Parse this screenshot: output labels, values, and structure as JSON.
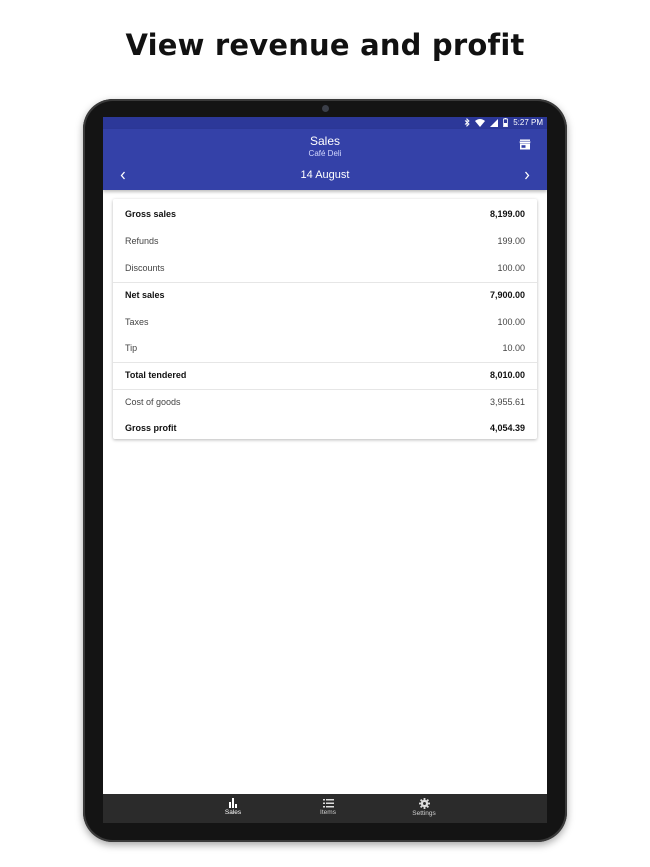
{
  "promo": {
    "headline": "View revenue and profit"
  },
  "status_bar": {
    "time": "5:27 PM",
    "icons": [
      "bluetooth-icon",
      "wifi-icon",
      "signal-icon",
      "battery-icon"
    ]
  },
  "app_bar": {
    "title": "Sales",
    "subtitle": "Café Deli",
    "action_icon": "store-icon"
  },
  "date_nav": {
    "date": "14 August",
    "prev_icon": "chevron-left-icon",
    "next_icon": "chevron-right-icon"
  },
  "sales_summary": {
    "rows": [
      {
        "label": "Gross sales",
        "value": "8,199.00"
      },
      {
        "label": "Refunds",
        "value": "199.00"
      },
      {
        "label": "Discounts",
        "value": "100.00"
      },
      {
        "label": "Net sales",
        "value": "7,900.00"
      },
      {
        "label": "Taxes",
        "value": "100.00"
      },
      {
        "label": "Tip",
        "value": "10.00"
      },
      {
        "label": "Total tendered",
        "value": "8,010.00"
      },
      {
        "label": "Cost of goods",
        "value": "3,955.61"
      },
      {
        "label": "Gross profit",
        "value": "4,054.39"
      }
    ]
  },
  "bottom_nav": {
    "items": [
      {
        "label": "Sales",
        "icon": "bar-chart-icon",
        "active": true
      },
      {
        "label": "Items",
        "icon": "list-icon",
        "active": false
      },
      {
        "label": "Settings",
        "icon": "gear-icon",
        "active": false
      }
    ]
  },
  "colors": {
    "app_bar": "#3441a8",
    "status_bar": "#2c3899",
    "bottom_nav": "#2b2b2b"
  }
}
